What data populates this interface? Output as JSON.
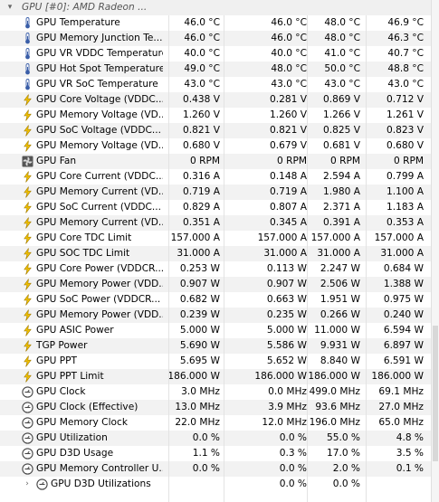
{
  "header": {
    "title": "GPU [#0]: AMD Radeon ..."
  },
  "rows": [
    {
      "icon": "thermometer-icon",
      "name": "GPU Temperature",
      "v": [
        "46.0 °C",
        "46.0 °C",
        "48.0 °C",
        "46.9 °C"
      ]
    },
    {
      "icon": "thermometer-icon",
      "name": "GPU Memory Junction Te...",
      "v": [
        "46.0 °C",
        "46.0 °C",
        "48.0 °C",
        "46.3 °C"
      ]
    },
    {
      "icon": "thermometer-icon",
      "name": "GPU VR VDDC Temperature",
      "v": [
        "40.0 °C",
        "40.0 °C",
        "41.0 °C",
        "40.7 °C"
      ]
    },
    {
      "icon": "thermometer-icon",
      "name": "GPU Hot Spot Temperature",
      "v": [
        "49.0 °C",
        "48.0 °C",
        "50.0 °C",
        "48.8 °C"
      ]
    },
    {
      "icon": "thermometer-icon",
      "name": "GPU VR SoC Temperature",
      "v": [
        "43.0 °C",
        "43.0 °C",
        "43.0 °C",
        "43.0 °C"
      ]
    },
    {
      "icon": "lightning-icon",
      "name": "GPU Core Voltage (VDDC...",
      "v": [
        "0.438 V",
        "0.281 V",
        "0.869 V",
        "0.712 V"
      ]
    },
    {
      "icon": "lightning-icon",
      "name": "GPU Memory Voltage (VD...",
      "v": [
        "1.260 V",
        "1.260 V",
        "1.266 V",
        "1.261 V"
      ]
    },
    {
      "icon": "lightning-icon",
      "name": "GPU SoC Voltage (VDDC...",
      "v": [
        "0.821 V",
        "0.821 V",
        "0.825 V",
        "0.823 V"
      ]
    },
    {
      "icon": "lightning-icon",
      "name": "GPU Memory Voltage (VD...",
      "v": [
        "0.680 V",
        "0.679 V",
        "0.681 V",
        "0.680 V"
      ]
    },
    {
      "icon": "fan-icon",
      "name": "GPU Fan",
      "v": [
        "0 RPM",
        "0 RPM",
        "0 RPM",
        "0 RPM"
      ]
    },
    {
      "icon": "lightning-icon",
      "name": "GPU Core Current (VDDC...",
      "v": [
        "0.316 A",
        "0.148 A",
        "2.594 A",
        "0.799 A"
      ]
    },
    {
      "icon": "lightning-icon",
      "name": "GPU Memory Current (VD...",
      "v": [
        "0.719 A",
        "0.719 A",
        "1.980 A",
        "1.100 A"
      ]
    },
    {
      "icon": "lightning-icon",
      "name": "GPU SoC Current (VDDC...",
      "v": [
        "0.829 A",
        "0.807 A",
        "2.371 A",
        "1.183 A"
      ]
    },
    {
      "icon": "lightning-icon",
      "name": "GPU Memory Current (VD...",
      "v": [
        "0.351 A",
        "0.345 A",
        "0.391 A",
        "0.353 A"
      ]
    },
    {
      "icon": "lightning-icon",
      "name": "GPU Core TDC Limit",
      "v": [
        "157.000 A",
        "157.000 A",
        "157.000 A",
        "157.000 A"
      ]
    },
    {
      "icon": "lightning-icon",
      "name": "GPU SOC TDC Limit",
      "v": [
        "31.000 A",
        "31.000 A",
        "31.000 A",
        "31.000 A"
      ]
    },
    {
      "icon": "lightning-icon",
      "name": "GPU Core Power (VDDCR...",
      "v": [
        "0.253 W",
        "0.113 W",
        "2.247 W",
        "0.684 W"
      ]
    },
    {
      "icon": "lightning-icon",
      "name": "GPU Memory Power (VDD...",
      "v": [
        "0.907 W",
        "0.907 W",
        "2.506 W",
        "1.388 W"
      ]
    },
    {
      "icon": "lightning-icon",
      "name": "GPU SoC Power (VDDCR...",
      "v": [
        "0.682 W",
        "0.663 W",
        "1.951 W",
        "0.975 W"
      ]
    },
    {
      "icon": "lightning-icon",
      "name": "GPU Memory Power (VDD...",
      "v": [
        "0.239 W",
        "0.235 W",
        "0.266 W",
        "0.240 W"
      ]
    },
    {
      "icon": "lightning-icon",
      "name": "GPU ASIC Power",
      "v": [
        "5.000 W",
        "5.000 W",
        "11.000 W",
        "6.594 W"
      ]
    },
    {
      "icon": "lightning-icon",
      "name": "TGP Power",
      "v": [
        "5.690 W",
        "5.586 W",
        "9.931 W",
        "6.897 W"
      ]
    },
    {
      "icon": "lightning-icon",
      "name": "GPU PPT",
      "v": [
        "5.695 W",
        "5.652 W",
        "8.840 W",
        "6.591 W"
      ]
    },
    {
      "icon": "lightning-icon",
      "name": "GPU PPT Limit",
      "v": [
        "186.000 W",
        "186.000 W",
        "186.000 W",
        "186.000 W"
      ]
    },
    {
      "icon": "clock-icon",
      "name": "GPU Clock",
      "v": [
        "3.0 MHz",
        "0.0 MHz",
        "499.0 MHz",
        "69.1 MHz"
      ]
    },
    {
      "icon": "clock-icon",
      "name": "GPU Clock (Effective)",
      "v": [
        "13.0 MHz",
        "3.9 MHz",
        "93.6 MHz",
        "27.0 MHz"
      ]
    },
    {
      "icon": "clock-icon",
      "name": "GPU Memory Clock",
      "v": [
        "22.0 MHz",
        "12.0 MHz",
        "196.0 MHz",
        "65.0 MHz"
      ]
    },
    {
      "icon": "clock-icon",
      "name": "GPU Utilization",
      "v": [
        "0.0 %",
        "0.0 %",
        "55.0 %",
        "4.8 %"
      ]
    },
    {
      "icon": "clock-icon",
      "name": "GPU D3D Usage",
      "v": [
        "1.1 %",
        "0.3 %",
        "17.0 %",
        "3.5 %"
      ]
    },
    {
      "icon": "clock-icon",
      "name": "GPU Memory Controller U...",
      "v": [
        "0.0 %",
        "0.0 %",
        "2.0 %",
        "0.1 %"
      ]
    },
    {
      "icon": "clock-icon",
      "name": "GPU D3D Utilizations",
      "expandable": true,
      "v": [
        "",
        "0.0 %",
        "0.0 %",
        ""
      ]
    }
  ]
}
